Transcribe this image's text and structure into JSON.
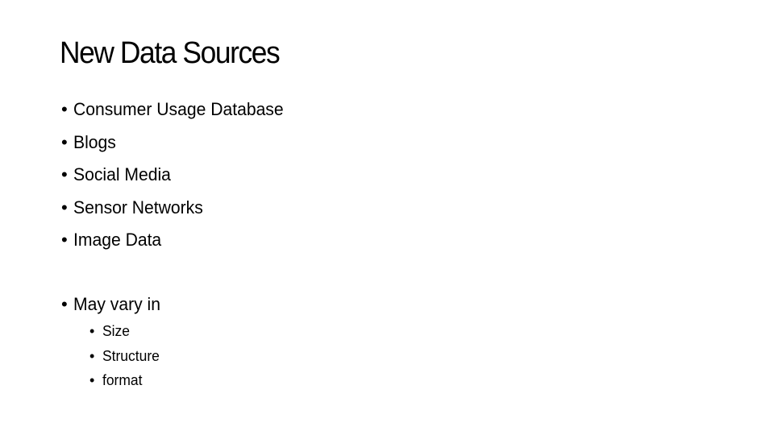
{
  "slide": {
    "title": "New Data Sources",
    "bullet_glyph": "•",
    "bullets": [
      {
        "label": "Consumer Usage Database"
      },
      {
        "label": "Blogs"
      },
      {
        "label": "Social Media"
      },
      {
        "label": "Sensor Networks"
      },
      {
        "label": "Image Data"
      }
    ],
    "second_group": {
      "label": "May vary in",
      "sub_bullets": [
        {
          "label": "Size"
        },
        {
          "label": "Structure"
        },
        {
          "label": "format"
        }
      ]
    }
  }
}
